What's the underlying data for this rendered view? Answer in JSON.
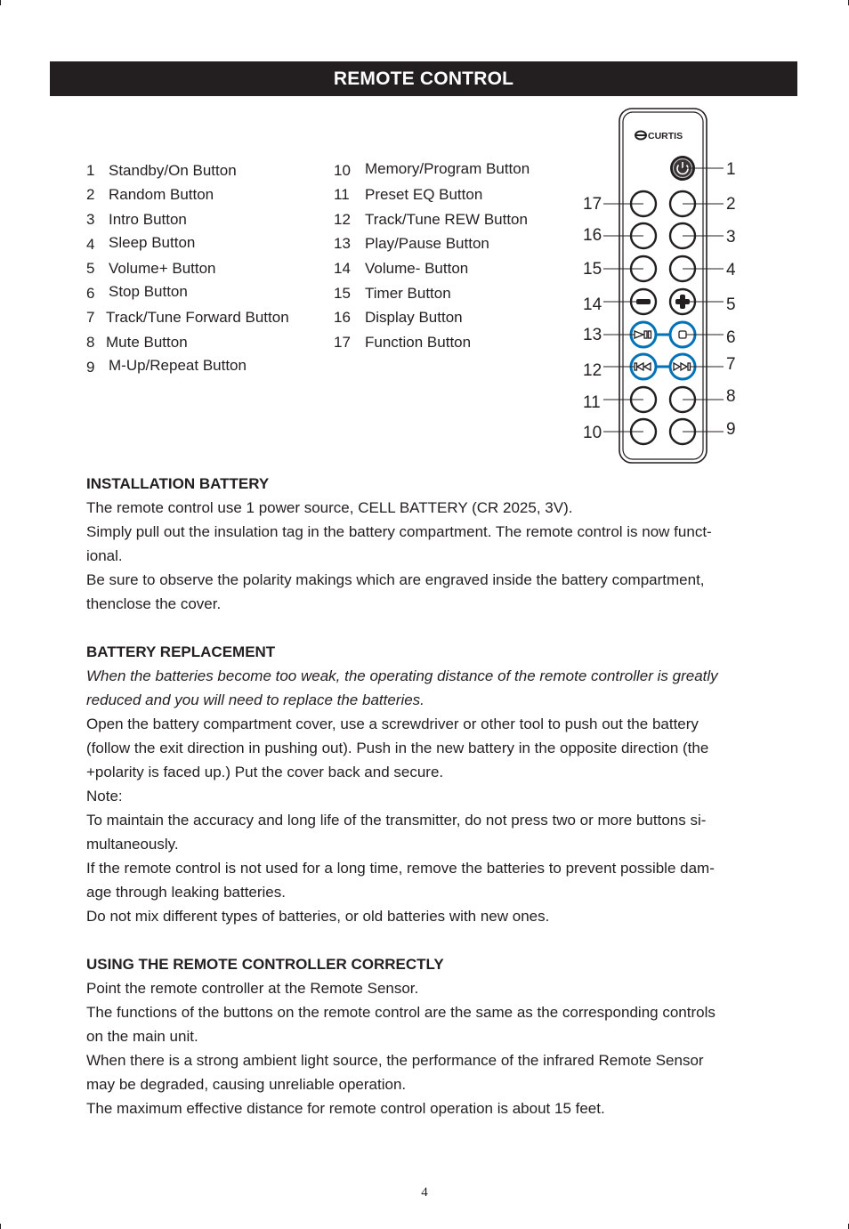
{
  "header": {
    "title": "REMOTE CONTROL"
  },
  "legend": {
    "left": [
      {
        "num": "1",
        "label": "Standby/On Button"
      },
      {
        "num": "2",
        "label": "Random Button"
      },
      {
        "num": "3",
        "label": "Intro  Button"
      },
      {
        "num": "4",
        "label": "Sleep Button"
      },
      {
        "num": "5",
        "label": "Volume+ Button"
      },
      {
        "num": "6",
        "label": "Stop Button"
      },
      {
        "num": "7",
        "label": "Track/Tune Forward Button"
      },
      {
        "num": "8",
        "label": "Mute Button"
      },
      {
        "num": "9",
        "label": "M-Up/Repeat Button"
      }
    ],
    "right": [
      {
        "num": "10",
        "label": "Memory/Program Button"
      },
      {
        "num": "11",
        "label": "Preset EQ Button"
      },
      {
        "num": "12",
        "label": "Track/Tune REW  Button"
      },
      {
        "num": "13",
        "label": "Play/Pause Button"
      },
      {
        "num": "14",
        "label": "Volume- Button"
      },
      {
        "num": "15",
        "label": "Timer Button"
      },
      {
        "num": "16",
        "label": "Display Button"
      },
      {
        "num": "17",
        "label": "Function Button"
      }
    ]
  },
  "remote": {
    "brand": "CURTIS",
    "accent_color": "#0072b5",
    "callouts_right": [
      "1",
      "2",
      "3",
      "4",
      "5",
      "6",
      "7",
      "8",
      "9"
    ],
    "callouts_left": [
      "17",
      "16",
      "15",
      "14",
      "13",
      "12",
      "11",
      "10"
    ]
  },
  "sections": {
    "installation": {
      "heading": "INSTALLATION BATTERY",
      "lines": [
        "The remote control use 1 power source, CELL BATTERY (CR 2025, 3V).",
        "Simply pull out the insulation tag in the battery compartment. The remote control is now funct-",
        "ional.",
        "Be sure to observe the polarity makings which are engraved inside the battery compartment,",
        "thenclose the cover."
      ]
    },
    "replacement": {
      "heading": "BATTERY REPLACEMENT",
      "italic_lines": [
        "When the batteries become too weak, the operating distance of the remote controller is greatly",
        "reduced and you will need to replace the batteries."
      ],
      "lines": [
        "Open the battery compartment cover, use a screwdriver or other tool to push out the battery",
        "(follow the exit direction in pushing out). Push in the new battery in the opposite direction (the",
        "+polarity is faced up.) Put the cover back and secure.",
        "Note:",
        "To maintain the accuracy and long life of the transmitter, do not press two or more buttons si-",
        "multaneously.",
        "If the remote control is not used for a long time, remove the batteries to prevent possible dam-",
        "age through leaking batteries.",
        "Do not mix different types of batteries, or old batteries with new ones."
      ]
    },
    "usage": {
      "heading": "USING THE REMOTE CONTROLLER CORRECTLY",
      "lines": [
        "Point the remote controller at the Remote Sensor.",
        "The functions of the buttons on the remote control are the same as the corresponding controls",
        "on the main unit.",
        "When there is a strong ambient light source, the performance of the infrared Remote Sensor",
        "may be degraded, causing unreliable operation.",
        "The maximum effective distance for remote control operation is about 15 feet."
      ]
    }
  },
  "footer": {
    "page_number": "4"
  }
}
